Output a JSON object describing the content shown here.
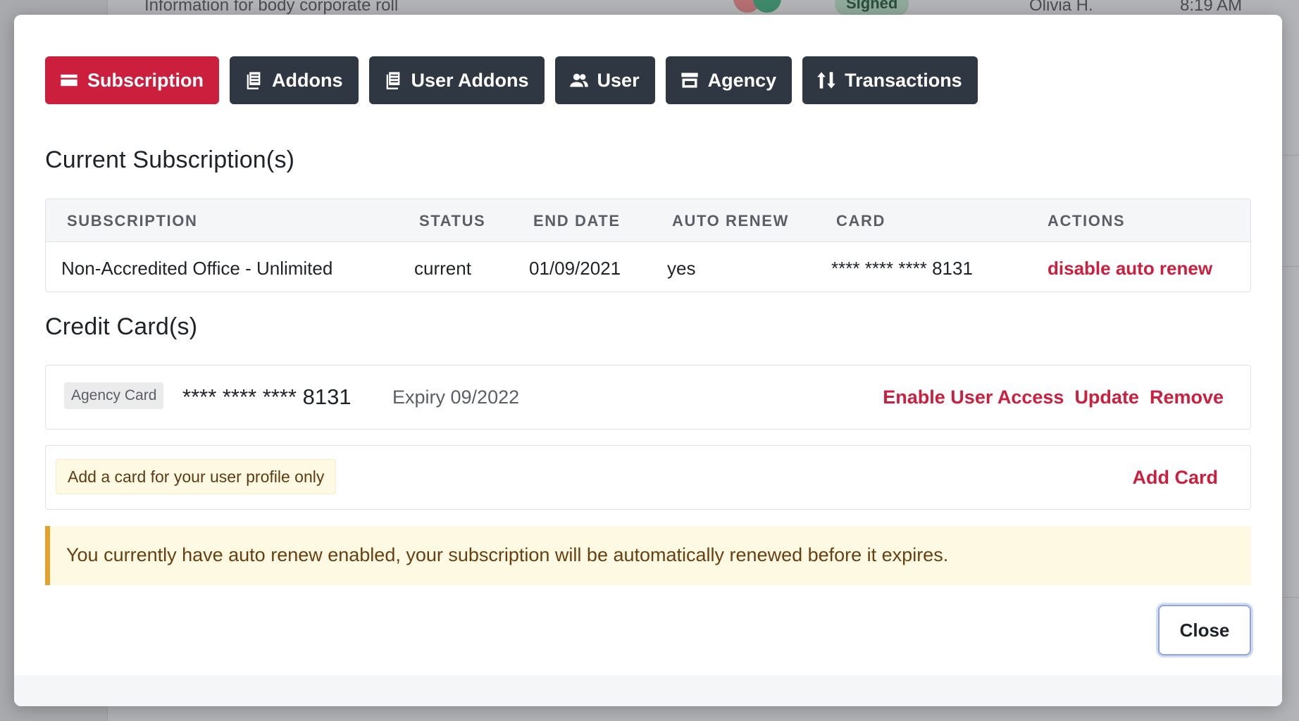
{
  "background": {
    "row_text": "Information for body corporate roll",
    "badge": "Signed",
    "name": "Olivia H.",
    "time": "8:19 AM"
  },
  "tabs": [
    {
      "label": "Subscription",
      "icon": "credit-card-icon",
      "active": true
    },
    {
      "label": "Addons",
      "icon": "stack-icon",
      "active": false
    },
    {
      "label": "User Addons",
      "icon": "stack-icon",
      "active": false
    },
    {
      "label": "User",
      "icon": "users-icon",
      "active": false
    },
    {
      "label": "Agency",
      "icon": "store-icon",
      "active": false
    },
    {
      "label": "Transactions",
      "icon": "arrows-up-down-icon",
      "active": false
    }
  ],
  "subscriptions": {
    "title": "Current Subscription(s)",
    "columns": [
      "SUBSCRIPTION",
      "STATUS",
      "END DATE",
      "AUTO RENEW",
      "CARD",
      "ACTIONS"
    ],
    "rows": [
      {
        "subscription": "Non-Accredited Office - Unlimited",
        "status": "current",
        "end_date": "01/09/2021",
        "auto_renew": "yes",
        "card": "**** **** **** 8131",
        "action": "disable auto renew"
      }
    ]
  },
  "cards": {
    "title": "Credit Card(s)",
    "items": [
      {
        "tag": "Agency Card",
        "number": "**** **** **** 8131",
        "expiry": "Expiry 09/2022",
        "actions": [
          "Enable User Access",
          "Update",
          "Remove"
        ]
      }
    ],
    "add_hint": "Add a card for your user profile only",
    "add_label": "Add Card"
  },
  "alert": {
    "text": "You currently have auto renew enabled, your subscription will be automatically renewed before it expires."
  },
  "footer": {
    "close_label": "Close"
  },
  "colors": {
    "accent": "#cc1f3d",
    "tab_dark": "#2f3742",
    "alert_bg": "#fdf9e3",
    "alert_border": "#e3a22b"
  }
}
